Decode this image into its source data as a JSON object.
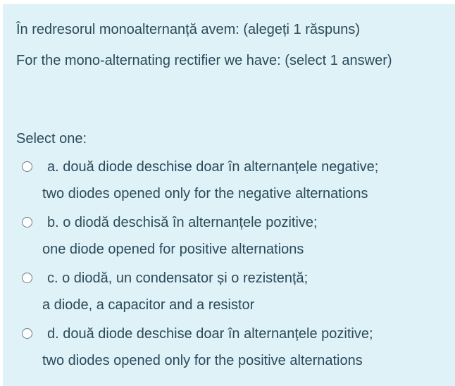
{
  "question": {
    "line_ro": "În redresorul monoalternanță avem: (alegeți 1 răspuns)",
    "line_en": "For the mono-alternating rectifier we have: (select 1 answer)"
  },
  "prompt": "Select one:",
  "answers": [
    {
      "letter_text": "a. două diode deschise doar în alternanțele negative;",
      "translation": "two diodes opened only for the negative alternations",
      "selected": false
    },
    {
      "letter_text": "b. o diodă deschisă în alternanțele pozitive;",
      "translation": "one diode opened for positive alternations",
      "selected": false
    },
    {
      "letter_text": "c. o diodă, un condensator și o rezistență;",
      "translation": "a diode, a capacitor and a resistor",
      "selected": false
    },
    {
      "letter_text": "d. două diode deschise doar în alternanțele pozitive;",
      "translation": "two diodes opened only for the positive alternations",
      "selected": false
    }
  ],
  "colors": {
    "panel_background": "#def2f8",
    "text": "#2c4a5a",
    "radio_border": "#6b7a85"
  }
}
